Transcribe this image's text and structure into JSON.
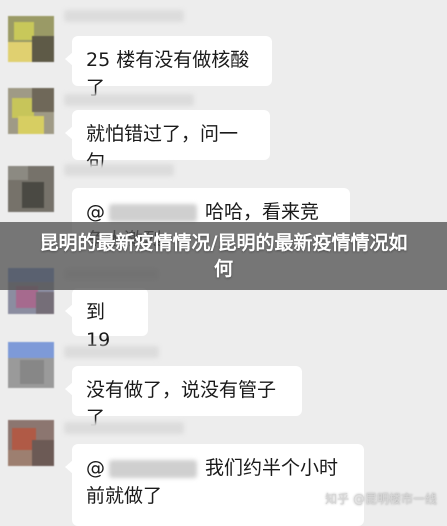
{
  "messages": [
    {
      "text": "25 楼有没有做核酸了"
    },
    {
      "text": "就怕错过了，问一句"
    },
    {
      "mention_symbol": "@",
      "text": "哈哈，看来竞争太激烈"
    },
    {
      "text": "到 19"
    },
    {
      "text": "没有做了，说没有管子了"
    },
    {
      "mention_symbol": "@",
      "text": "我们约半个小时前就做了"
    }
  ],
  "overlay": {
    "title": "昆明的最新疫情情况/昆明的最新疫情情况如何"
  },
  "watermark": {
    "text": "知乎 @昆明楼市一线"
  },
  "colors": {
    "background": "#ededed",
    "bubble": "#ffffff",
    "overlay": "#555555"
  }
}
